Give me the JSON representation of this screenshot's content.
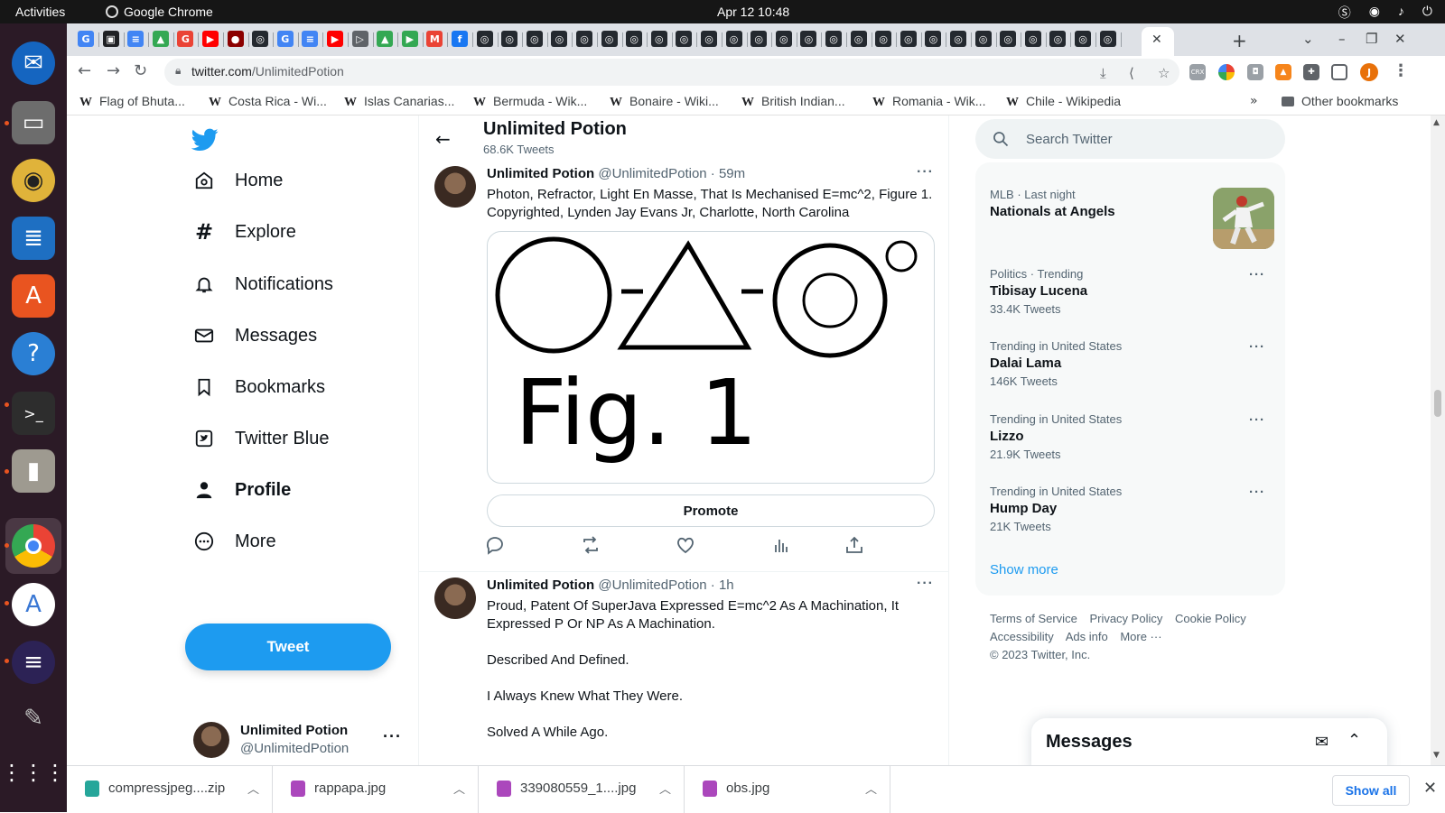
{
  "os": {
    "activities": "Activities",
    "app_name": "Google Chrome",
    "clock": "Apr 12  10:48"
  },
  "browser": {
    "url_host": "twitter.com",
    "url_path": "/UnlimitedPotion",
    "bookmarks": [
      "Flag of Bhuta...",
      "Costa Rica - Wi...",
      "Islas Canarias...",
      "Bermuda - Wik...",
      "Bonaire - Wiki...",
      "British Indian...",
      "Romania - Wik...",
      "Chile - Wikipedia"
    ],
    "other_bookmarks": "Other bookmarks",
    "profile_initial": "J",
    "ext_crx": "CRX"
  },
  "sidebar": {
    "items": [
      {
        "label": "Home",
        "icon": "home-icon"
      },
      {
        "label": "Explore",
        "icon": "hashtag-icon"
      },
      {
        "label": "Notifications",
        "icon": "bell-icon"
      },
      {
        "label": "Messages",
        "icon": "envelope-icon"
      },
      {
        "label": "Bookmarks",
        "icon": "bookmark-icon"
      },
      {
        "label": "Twitter Blue",
        "icon": "twitter-blue-icon"
      },
      {
        "label": "Profile",
        "icon": "person-icon"
      },
      {
        "label": "More",
        "icon": "more-circle-icon"
      }
    ],
    "tweet_button": "Tweet",
    "account_name": "Unlimited Potion",
    "account_handle": "@UnlimitedPotion"
  },
  "profile_header": {
    "title": "Unlimited Potion",
    "tweet_count": "68.6K Tweets"
  },
  "tweets": [
    {
      "name": "Unlimited Potion",
      "handle": "@UnlimitedPotion · 59m",
      "text": "Photon, Refractor, Light En Masse, That Is Mechanised E=mc^2, Figure 1. Copyrighted, Lynden Jay Evans Jr, Charlotte, North Carolina",
      "media_caption": "Fig. 1",
      "promote_label": "Promote"
    },
    {
      "name": "Unlimited Potion",
      "handle": "@UnlimitedPotion · 1h",
      "text": "Proud, Patent Of SuperJava Expressed E=mc^2 As A Machination, It Expressed P Or NP As A Machination.\n\nDescribed And Defined.\n\nI Always Knew What They Were.\n\nSolved A While Ago."
    }
  ],
  "search": {
    "placeholder": "Search Twitter"
  },
  "trends": [
    {
      "context": "MLB · Last night",
      "name": "Nationals at Angels",
      "count": ""
    },
    {
      "context": "Politics · Trending",
      "name": "Tibisay Lucena",
      "count": "33.4K Tweets"
    },
    {
      "context": "Trending in United States",
      "name": "Dalai Lama",
      "count": "146K Tweets"
    },
    {
      "context": "Trending in United States",
      "name": "Lizzo",
      "count": "21.9K Tweets"
    },
    {
      "context": "Trending in United States",
      "name": "Hump Day",
      "count": "21K Tweets"
    }
  ],
  "show_more": "Show more",
  "footer": {
    "links": [
      "Terms of Service",
      "Privacy Policy",
      "Cookie Policy",
      "Accessibility",
      "Ads info",
      "More ···"
    ],
    "copyright": "© 2023 Twitter, Inc."
  },
  "messages_drawer": {
    "title": "Messages"
  },
  "downloads": {
    "items": [
      {
        "name": "compressjpeg....zip",
        "color": "#26a69a"
      },
      {
        "name": "rappapa.jpg",
        "color": "#ab47bc"
      },
      {
        "name": "339080559_1....jpg",
        "color": "#ab47bc"
      },
      {
        "name": "obs.jpg",
        "color": "#ab47bc"
      }
    ],
    "show_all": "Show all"
  },
  "colors": {
    "twitter_blue": "#1d9bf0",
    "ubuntu_orange": "#e95420",
    "dock_bg": "#2b1a26"
  }
}
